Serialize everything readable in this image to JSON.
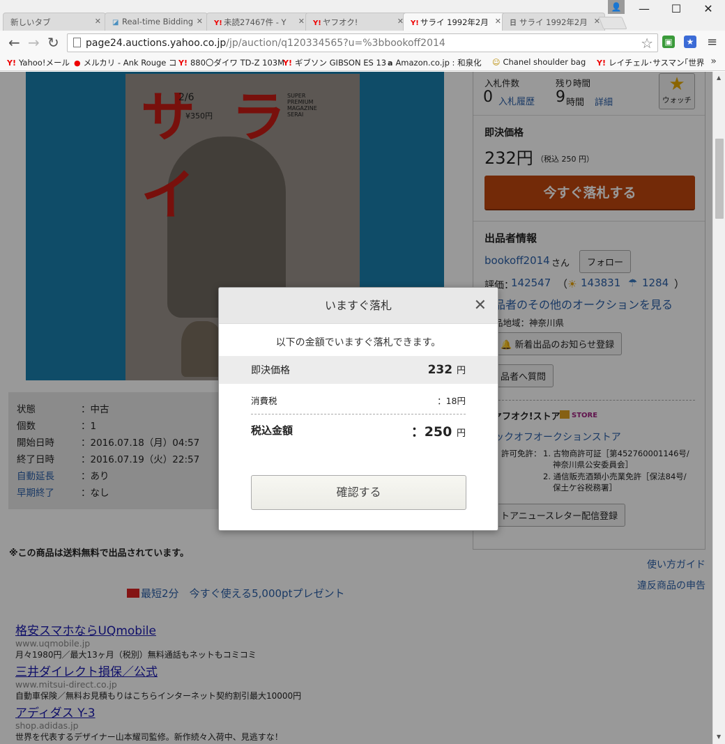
{
  "tabs": [
    {
      "label": "新しいタブ",
      "favicon": ""
    },
    {
      "label": "Real-time Bidding",
      "favicon": "ad-icon"
    },
    {
      "label": "未読27467件 - Y",
      "favicon": "yahoo-icon"
    },
    {
      "label": "ヤフオク!",
      "favicon": "yahoo-icon"
    },
    {
      "label": "サライ 1992年2月",
      "favicon": "yahoo-icon"
    },
    {
      "label": "サライ 1992年2月",
      "favicon": "bookmark-icon"
    }
  ],
  "window": {
    "minimize": "—",
    "maximize": "☐",
    "close": "✕"
  },
  "address": {
    "host": "page24.auctions.yahoo.co.jp",
    "path": "/jp/auction/q120334565?u=%3bbookoff2014"
  },
  "bookmarks": [
    "Yahoo!メール",
    "メルカリ - Ank Rouge コ",
    "880〇ダイワ TD-Z 103M",
    "ギブソン GIBSON ES 13",
    "Amazon.co.jp : 和泉化",
    "Chanel shoulder bag",
    "レイチェル･サスマン｢世界"
  ],
  "magazine": {
    "title": "サライ",
    "issue": "2/6",
    "price": "¥350円",
    "subtitle": "SUPER PREMIUM MAGAZINE SERAI"
  },
  "specs": [
    {
      "key": "状態",
      "value": "：中古",
      "link": false
    },
    {
      "key": "個数",
      "value": "：1",
      "link": false
    },
    {
      "key": "開始日時",
      "value": "：2016.07.18（月）04:57",
      "link": false
    },
    {
      "key": "終了日時",
      "value": "：2016.07.19（火）22:57",
      "link": false
    },
    {
      "key": "自動延長",
      "value": "：あり",
      "link": true
    },
    {
      "key": "早期終了",
      "value": "：なし",
      "link": true
    }
  ],
  "free_shipping": "※この商品は送料無料で出品されています。",
  "promo": {
    "prefix": "最短2分",
    "text": "今すぐ使える5,000ptプレゼント"
  },
  "ads": [
    {
      "title": "格安スマホならUQmobile",
      "url": "www.uqmobile.jp",
      "desc": "月々1980円／最大13ヶ月（税別）無料通話もネットもコミコミ"
    },
    {
      "title": "三井ダイレクト損保／公式",
      "url": "www.mitsui-direct.co.jp",
      "desc": "自動車保険／無料お見積もりはこちらインターネット契約割引最大10000円"
    },
    {
      "title": "アディダス Y-3",
      "url": "shop.adidas.jp",
      "desc": "世界を代表するデザイナー山本耀司監修。新作続々入荷中、見逃すな！"
    }
  ],
  "side": {
    "bids_label": "入札件数",
    "bids_value": "0",
    "bid_history": "入札履歴",
    "time_label": "残り時間",
    "time_value": "9",
    "time_unit": "時間",
    "detail": "詳細",
    "watch": "ウォッチ",
    "buynow_label": "即決価格",
    "buynow_price": "232円",
    "buynow_tax": "（税込 250 円）",
    "buynow_button": "今すぐ落札する",
    "seller_heading": "出品者情報",
    "seller_name": "bookoff2014",
    "seller_suffix": "さん",
    "follow": "フォロー",
    "rating_label": "評価：",
    "rating": "142547",
    "good": "143831",
    "bad": "1284",
    "other_auctions": "品者のその他のオークションを見る",
    "location": "品地域：神奈川県",
    "notify": "新着出品のお知らせ登録",
    "question": "品者へ質問",
    "store_label": "ヤフオク!ストア",
    "store_badge": "STORE",
    "store_name": "ックオフオークションストア",
    "license_label": "許可免許：",
    "license_1": "1. 古物商許可証［第452760001146号/",
    "license_1b": "神奈川県公安委員会］",
    "license_2": "2. 通信販売酒類小売業免許［保法84号/",
    "license_2b": "保土ケ谷税務署］",
    "newsletter": "トアニュースレター配信登録"
  },
  "links": {
    "guide": "使い方ガイド",
    "report": "違反商品の申告"
  },
  "modal": {
    "title": "いますぐ落札",
    "message": "以下の金額でいますぐ落札できます。",
    "price_label": "即決価格",
    "price_value": "232",
    "yen": "円",
    "tax_label": "消費税",
    "tax_value": "：18円",
    "total_label": "税込金額",
    "total_value": "：250",
    "total_yen": "円",
    "confirm": "確認する"
  }
}
